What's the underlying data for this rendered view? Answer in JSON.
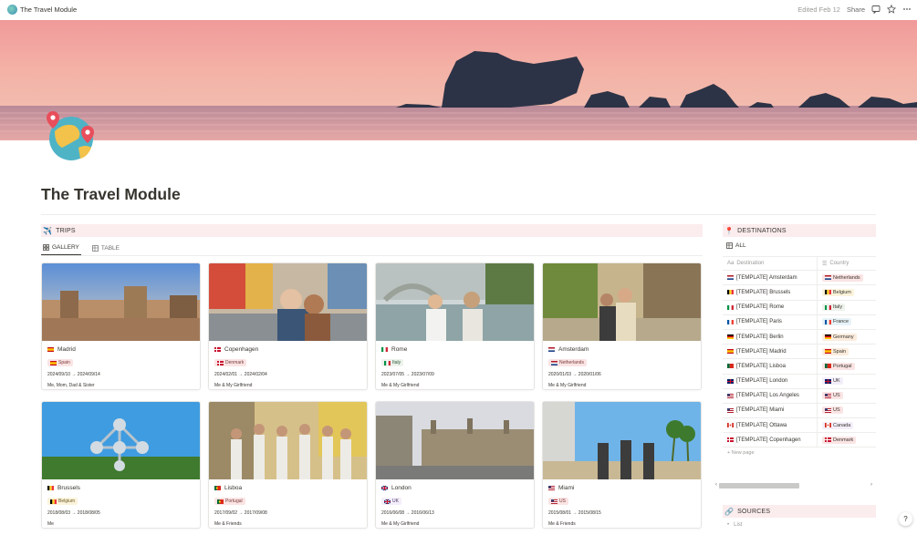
{
  "topbar": {
    "title": "The Travel Module",
    "edited": "Edited Feb 12",
    "share": "Share",
    "icons": [
      "comment-icon",
      "star-icon",
      "more-icon"
    ]
  },
  "page": {
    "title": "The Travel Module",
    "icon": "globe-pin-icon"
  },
  "trips": {
    "heading": "TRIPS",
    "heading_icon": "✈️",
    "tabs": [
      {
        "label": "GALLERY",
        "icon": "gallery-icon",
        "active": true
      },
      {
        "label": "TABLE",
        "icon": "table-icon",
        "active": false
      }
    ],
    "cards": [
      {
        "name": "Madrid",
        "country": "Spain",
        "dates": "2024/09/10 → 2024/09/14",
        "who": "Me, Mom, Dad & Sister"
      },
      {
        "name": "Copenhagen",
        "country": "Denmark",
        "dates": "2024/02/01 → 2024/02/04",
        "who": "Me & My Girlfriend"
      },
      {
        "name": "Rome",
        "country": "Italy",
        "dates": "2023/07/05 → 2023/07/09",
        "who": "Me & My Girlfriend"
      },
      {
        "name": "Amsterdam",
        "country": "Netherlands",
        "dates": "2020/01/03 → 2020/01/06",
        "who": "Me & My Girlfriend"
      },
      {
        "name": "Brussels",
        "country": "Belgium",
        "dates": "2018/08/03 → 2018/08/05",
        "who": "Me"
      },
      {
        "name": "Lisboa",
        "country": "Portugal",
        "dates": "2017/09/02 → 2017/09/08",
        "who": "Me & Friends"
      },
      {
        "name": "London",
        "country": "UK",
        "dates": "2016/06/08 → 2016/06/13",
        "who": "Me & My Girlfriend"
      },
      {
        "name": "Miami",
        "country": "US",
        "dates": "2015/08/01 → 2015/08/15",
        "who": "Me & Friends"
      }
    ]
  },
  "destinations": {
    "heading": "DESTINATIONS",
    "heading_icon": "📍",
    "view": "ALL",
    "col_destination": "Destination",
    "col_country": "Country",
    "rows": [
      {
        "destination": "[TEMPLATE] Amsterdam",
        "country": "Netherlands",
        "color": "#fbe4e4"
      },
      {
        "destination": "[TEMPLATE] Brussels",
        "country": "Belgium",
        "color": "#fbf3db"
      },
      {
        "destination": "[TEMPLATE] Rome",
        "country": "Italy",
        "color": "#edf3ec"
      },
      {
        "destination": "[TEMPLATE] Paris",
        "country": "France",
        "color": "#e7f3f8"
      },
      {
        "destination": "[TEMPLATE] Berlin",
        "country": "Germany",
        "color": "#fbecdd"
      },
      {
        "destination": "[TEMPLATE] Madrid",
        "country": "Spain",
        "color": "#fbecdd"
      },
      {
        "destination": "[TEMPLATE] Lisboa",
        "country": "Portugal",
        "color": "#fbe4e4"
      },
      {
        "destination": "[TEMPLATE] London",
        "country": "UK",
        "color": "#f4eefa"
      },
      {
        "destination": "[TEMPLATE] Los Angeles",
        "country": "US",
        "color": "#fbe4e4"
      },
      {
        "destination": "[TEMPLATE] Miami",
        "country": "US",
        "color": "#fbe4e4"
      },
      {
        "destination": "[TEMPLATE] Ottawa",
        "country": "Canada",
        "color": "#f4eefa"
      },
      {
        "destination": "[TEMPLATE] Copenhagen",
        "country": "Denmark",
        "color": "#fbe4e4"
      }
    ],
    "new_page": "New page"
  },
  "sources": {
    "heading": "SOURCES",
    "heading_icon": "🔗",
    "list_label": "List"
  },
  "help": "?"
}
